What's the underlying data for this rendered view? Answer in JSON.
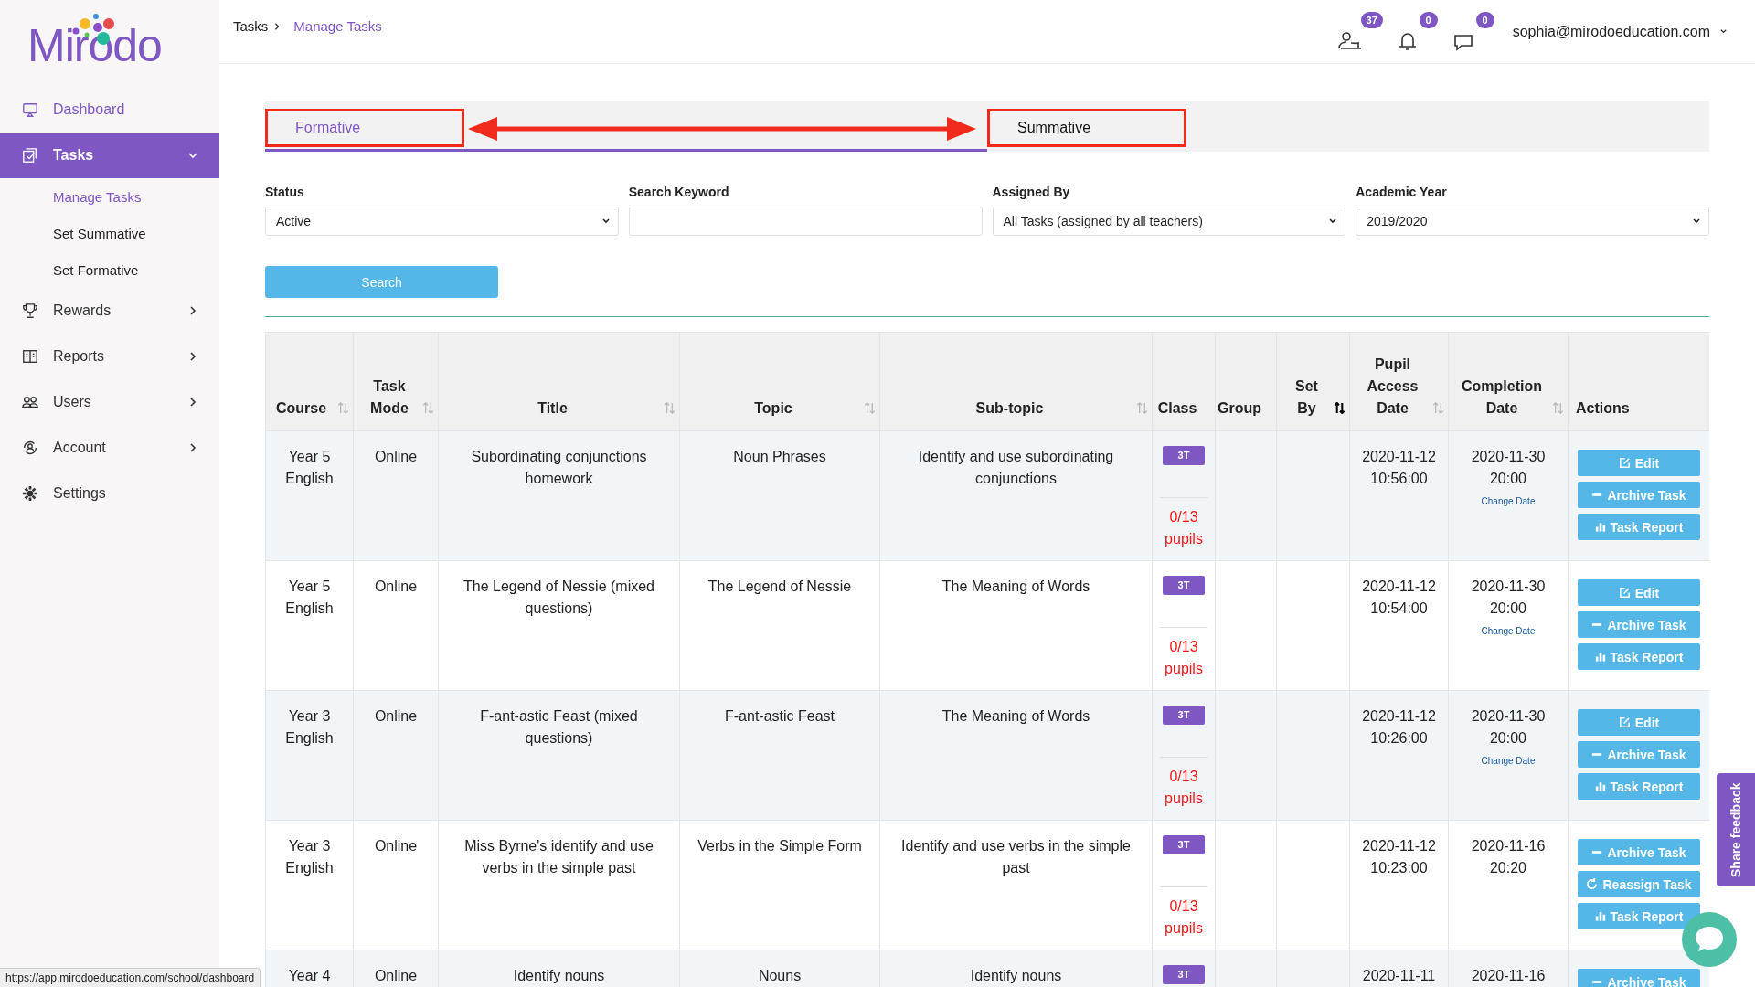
{
  "logo": {
    "text": "Mirodo"
  },
  "sidebar": {
    "items": [
      {
        "label": "Dashboard",
        "selected": false,
        "hovered": true,
        "has_chevron": false
      },
      {
        "label": "Tasks",
        "selected": true,
        "hovered": false,
        "has_chevron": true,
        "expanded": true,
        "children": [
          {
            "label": "Manage Tasks",
            "selected": true
          },
          {
            "label": "Set Summative",
            "selected": false
          },
          {
            "label": "Set Formative",
            "selected": false
          }
        ]
      },
      {
        "label": "Rewards",
        "selected": false,
        "hovered": false,
        "has_chevron": true,
        "expanded": false
      },
      {
        "label": "Reports",
        "selected": false,
        "hovered": false,
        "has_chevron": true,
        "expanded": false
      },
      {
        "label": "Users",
        "selected": false,
        "hovered": false,
        "has_chevron": true,
        "expanded": false
      },
      {
        "label": "Account",
        "selected": false,
        "hovered": false,
        "has_chevron": true,
        "expanded": false
      },
      {
        "label": "Settings",
        "selected": false,
        "hovered": false,
        "has_chevron": false
      }
    ]
  },
  "breadcrumb": [
    {
      "label": "Tasks",
      "current": false
    },
    {
      "label": "Manage Tasks",
      "current": true
    }
  ],
  "header": {
    "badges": [
      "37",
      "0",
      "0"
    ],
    "user": "sophia@mirodoeducation.com"
  },
  "tabs": {
    "double_arrow": true,
    "items": [
      {
        "label": "Formative",
        "selected": true,
        "framed": true
      },
      {
        "label": "Summative",
        "selected": false,
        "framed": true
      }
    ]
  },
  "filters": [
    {
      "label": "Status",
      "kind": "select",
      "value": "Active"
    },
    {
      "label": "Search Keyword",
      "kind": "text"
    },
    {
      "label": "Assigned By",
      "kind": "select",
      "value": "All Tasks (assigned by all teachers)"
    },
    {
      "label": "Academic Year",
      "kind": "select",
      "value": "2019/2020"
    }
  ],
  "search_button": "Search",
  "table": {
    "columns": [
      {
        "label": "Course",
        "sortable": true,
        "sorted": false
      },
      {
        "label": "Task Mode",
        "sortable": true,
        "sorted": false
      },
      {
        "label": "Title",
        "sortable": true,
        "sorted": false
      },
      {
        "label": "Topic",
        "sortable": true,
        "sorted": false
      },
      {
        "label": "Sub-topic",
        "sortable": true,
        "sorted": false
      },
      {
        "label": "Class",
        "sortable": false,
        "sorted": false
      },
      {
        "label": "Group",
        "sortable": false,
        "sorted": false
      },
      {
        "label": "Set By",
        "sortable": true,
        "sorted": true
      },
      {
        "label": "Pupil Access Date",
        "sortable": true,
        "sorted": false
      },
      {
        "label": "Completion Date",
        "sortable": true,
        "sorted": false
      },
      {
        "label": "Actions",
        "sortable": false,
        "sorted": false
      }
    ],
    "rows": [
      {
        "course": "Year 5 English",
        "mode": "Online",
        "title": "Subordinating conjunctions homework",
        "topic": "Noun Phrases",
        "subtopic": "Identify and use subordinating conjunctions",
        "class": "3T",
        "progress": "0/13 pupils",
        "access": "2020-11-12 10:56:00",
        "completion": "2020-11-30 20:00",
        "change_date": "Change Date",
        "actions": [
          {
            "kind": "edit",
            "label": "Edit"
          },
          {
            "kind": "archive",
            "label": "Archive Task"
          },
          {
            "kind": "report",
            "label": "Task Report"
          }
        ]
      },
      {
        "course": "Year 5 English",
        "mode": "Online",
        "title": "The Legend of Nessie (mixed questions)",
        "topic": "The Legend of Nessie",
        "subtopic": "The Meaning of Words",
        "class": "3T",
        "progress": "0/13 pupils",
        "access": "2020-11-12 10:54:00",
        "completion": "2020-11-30 20:00",
        "change_date": "Change Date",
        "actions": [
          {
            "kind": "edit",
            "label": "Edit"
          },
          {
            "kind": "archive",
            "label": "Archive Task"
          },
          {
            "kind": "report",
            "label": "Task Report"
          }
        ]
      },
      {
        "course": "Year 3 English",
        "mode": "Online",
        "title": "F-ant-astic Feast (mixed questions)",
        "topic": "F-ant-astic Feast",
        "subtopic": "The Meaning of Words",
        "class": "3T",
        "progress": "0/13 pupils",
        "access": "2020-11-12 10:26:00",
        "completion": "2020-11-30 20:00",
        "change_date": "Change Date",
        "actions": [
          {
            "kind": "edit",
            "label": "Edit"
          },
          {
            "kind": "archive",
            "label": "Archive Task"
          },
          {
            "kind": "report",
            "label": "Task Report"
          }
        ]
      },
      {
        "course": "Year 3 English",
        "mode": "Online",
        "title": "Miss Byrne's identify and use verbs in the simple past",
        "topic": "Verbs in the Simple Form",
        "subtopic": "Identify and use verbs in the simple past",
        "class": "3T",
        "progress": "0/13 pupils",
        "access": "2020-11-12 10:23:00",
        "completion": "2020-11-16 20:20",
        "actions": [
          {
            "kind": "archive",
            "label": "Archive Task"
          },
          {
            "kind": "reassign",
            "label": "Reassign Task"
          },
          {
            "kind": "report",
            "label": "Task Report"
          }
        ]
      },
      {
        "course": "Year 4",
        "mode": "Online",
        "title": "Identify nouns",
        "topic": "Nouns",
        "subtopic": "Identify nouns",
        "class": "3T",
        "access": "2020-11-11",
        "completion": "2020-11-16",
        "actions": [
          {
            "kind": "archive",
            "label": "Archive Task"
          }
        ]
      }
    ]
  },
  "feedback_tab": "Share feedback",
  "status_url": "https://app.mirodoeducation.com/school/dashboard"
}
